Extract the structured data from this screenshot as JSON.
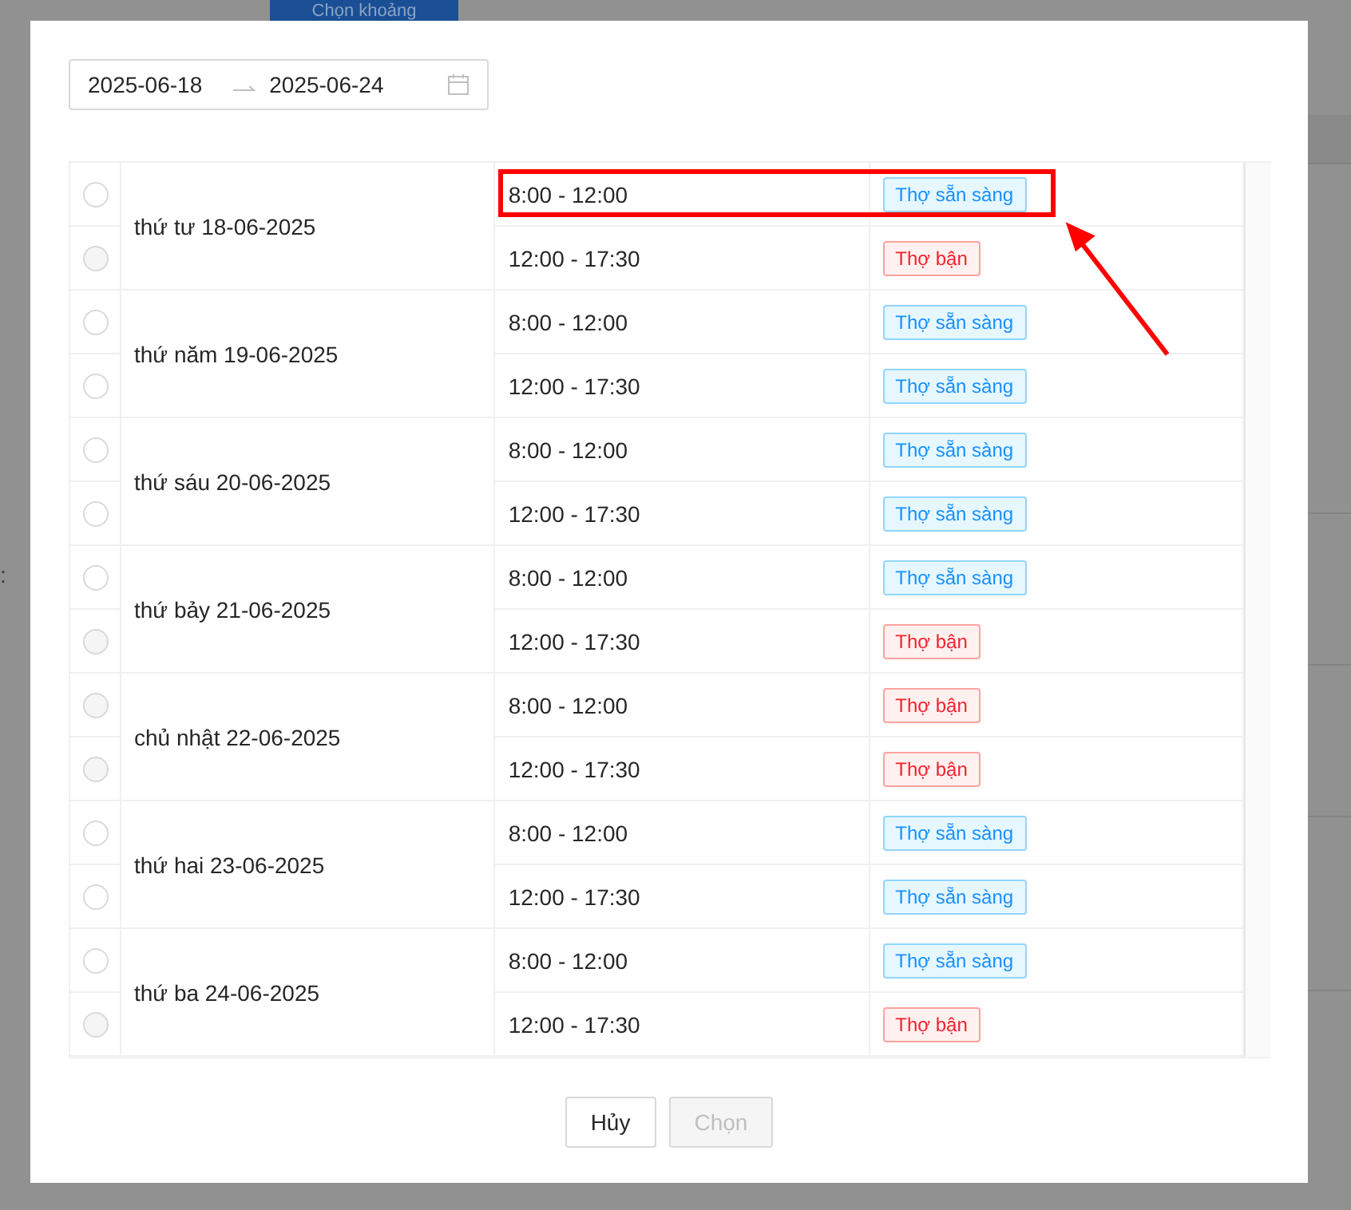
{
  "background": {
    "button": "Chọn khoảng",
    "label": ":"
  },
  "date_range": {
    "start": "2025-06-18",
    "end": "2025-06-24"
  },
  "days": [
    {
      "date": "thứ tư 18-06-2025",
      "slots": [
        {
          "time": "8:00 - 12:00",
          "status": "Thợ sẵn sàng",
          "kind": "available",
          "selected": false,
          "highlighted": true
        },
        {
          "time": "12:00 - 17:30",
          "status": "Thợ bận",
          "kind": "busy",
          "selected": false,
          "highlighted": false
        }
      ]
    },
    {
      "date": "thứ năm 19-06-2025",
      "slots": [
        {
          "time": "8:00 - 12:00",
          "status": "Thợ sẵn sàng",
          "kind": "available",
          "selected": false,
          "highlighted": false
        },
        {
          "time": "12:00 - 17:30",
          "status": "Thợ sẵn sàng",
          "kind": "available",
          "selected": false,
          "highlighted": false
        }
      ]
    },
    {
      "date": "thứ sáu 20-06-2025",
      "slots": [
        {
          "time": "8:00 - 12:00",
          "status": "Thợ sẵn sàng",
          "kind": "available",
          "selected": false,
          "highlighted": false
        },
        {
          "time": "12:00 - 17:30",
          "status": "Thợ sẵn sàng",
          "kind": "available",
          "selected": false,
          "highlighted": false
        }
      ]
    },
    {
      "date": "thứ bảy 21-06-2025",
      "slots": [
        {
          "time": "8:00 - 12:00",
          "status": "Thợ sẵn sàng",
          "kind": "available",
          "selected": false,
          "highlighted": false
        },
        {
          "time": "12:00 - 17:30",
          "status": "Thợ bận",
          "kind": "busy",
          "selected": false,
          "highlighted": false
        }
      ]
    },
    {
      "date": "chủ nhật 22-06-2025",
      "slots": [
        {
          "time": "8:00 - 12:00",
          "status": "Thợ bận",
          "kind": "busy",
          "selected": false,
          "highlighted": false
        },
        {
          "time": "12:00 - 17:30",
          "status": "Thợ bận",
          "kind": "busy",
          "selected": false,
          "highlighted": false
        }
      ]
    },
    {
      "date": "thứ hai 23-06-2025",
      "slots": [
        {
          "time": "8:00 - 12:00",
          "status": "Thợ sẵn sàng",
          "kind": "available",
          "selected": false,
          "highlighted": false
        },
        {
          "time": "12:00 - 17:30",
          "status": "Thợ sẵn sàng",
          "kind": "available",
          "selected": false,
          "highlighted": false
        }
      ]
    },
    {
      "date": "thứ ba 24-06-2025",
      "slots": [
        {
          "time": "8:00 - 12:00",
          "status": "Thợ sẵn sàng",
          "kind": "available",
          "selected": false,
          "highlighted": false
        },
        {
          "time": "12:00 - 17:30",
          "status": "Thợ bận",
          "kind": "busy",
          "selected": false,
          "highlighted": false
        }
      ]
    }
  ],
  "buttons": [
    {
      "label": "Hủy",
      "disabled": false
    },
    {
      "label": "Chọn",
      "disabled": true
    }
  ]
}
